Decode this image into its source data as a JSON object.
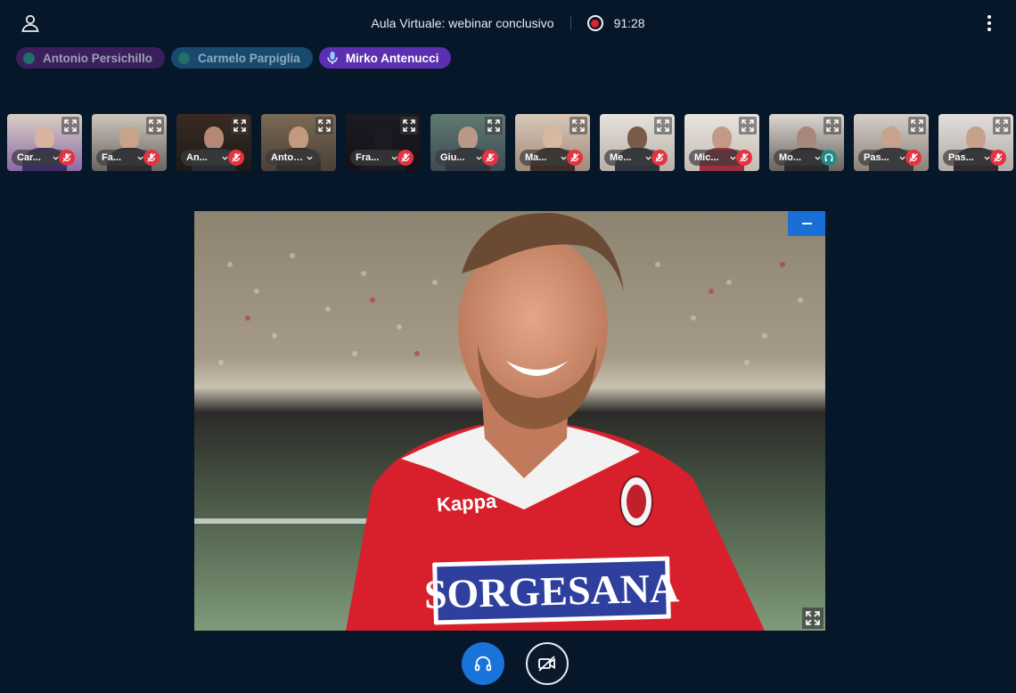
{
  "header": {
    "title": "Aula Virtuale: webinar conclusivo",
    "timer": "91:28",
    "user_icon": "user-icon",
    "menu_icon": "kebab-menu-icon",
    "recording_icon": "recording-icon"
  },
  "talkers": [
    {
      "name": "Antonio Persichillo"
    },
    {
      "name": "Carmelo Parpiglia"
    },
    {
      "name": "Mirko Antenucci",
      "active": true
    }
  ],
  "participants": [
    {
      "label": "Car..."
    },
    {
      "label": "Fa..."
    },
    {
      "label": "An..."
    },
    {
      "label": "Antoni..."
    },
    {
      "label": "Fra..."
    },
    {
      "label": "Giu..."
    },
    {
      "label": "Ma..."
    },
    {
      "label": "Me..."
    },
    {
      "label": "Mic..."
    },
    {
      "label": "Mo..."
    },
    {
      "label": "Pas..."
    },
    {
      "label": "Pas..."
    }
  ],
  "main_video": {
    "sponsor_text": "SORGESANA",
    "brand_text": "Kappa"
  },
  "controls": {
    "audio_icon": "headphones-icon",
    "video_icon": "video-off-icon"
  },
  "colors": {
    "background": "#06172a",
    "accent": "#1a73d9",
    "muted": "#e53340",
    "active_talker": "#5b2fb0"
  }
}
